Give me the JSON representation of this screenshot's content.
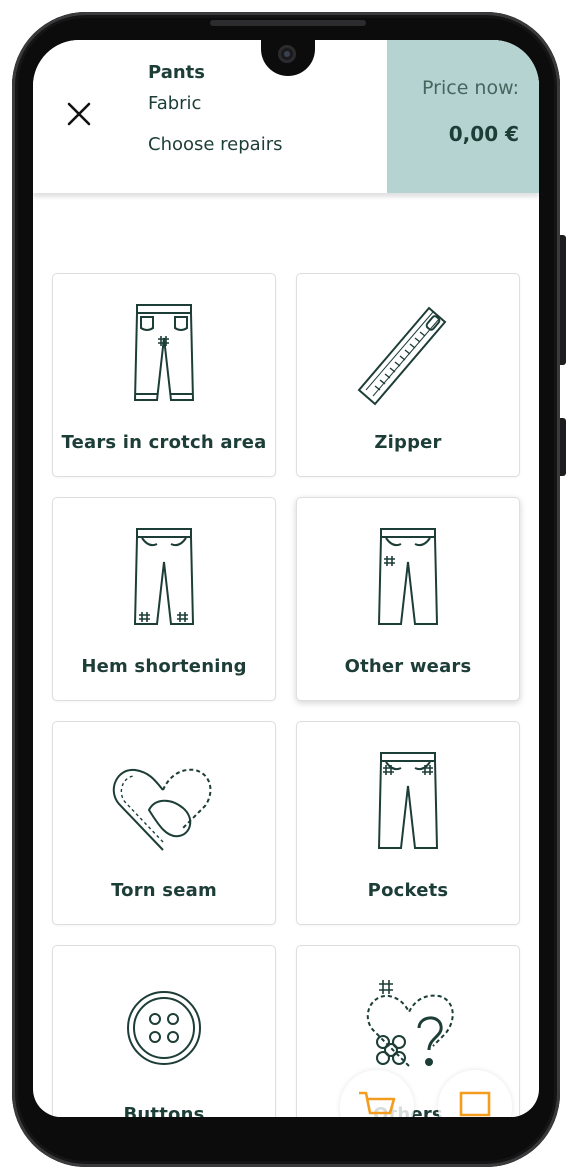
{
  "header": {
    "product": "Pants",
    "material": "Fabric",
    "step": "Choose repairs",
    "price_label": "Price now:",
    "price_value": "0,00 €"
  },
  "repairs": [
    {
      "label": "Tears in crotch area",
      "icon": "pants-crotch-patch-icon"
    },
    {
      "label": "Zipper",
      "icon": "zipper-icon"
    },
    {
      "label": "Hem shortening",
      "icon": "pants-hem-patch-icon"
    },
    {
      "label": "Other wears",
      "icon": "pants-patch-icon",
      "selected": true
    },
    {
      "label": "Torn seam",
      "icon": "torn-seam-heart-icon"
    },
    {
      "label": "Pockets",
      "icon": "pants-pockets-icon"
    },
    {
      "label": "Buttons",
      "icon": "button-icon"
    },
    {
      "label": "Others",
      "icon": "other-repairs-icon"
    }
  ],
  "colors": {
    "primary_text": "#1d3d37",
    "price_bg": "#b5d3d1",
    "accent": "#f39c1f"
  },
  "fab_icons": [
    "cart-icon",
    "chat-icon"
  ]
}
